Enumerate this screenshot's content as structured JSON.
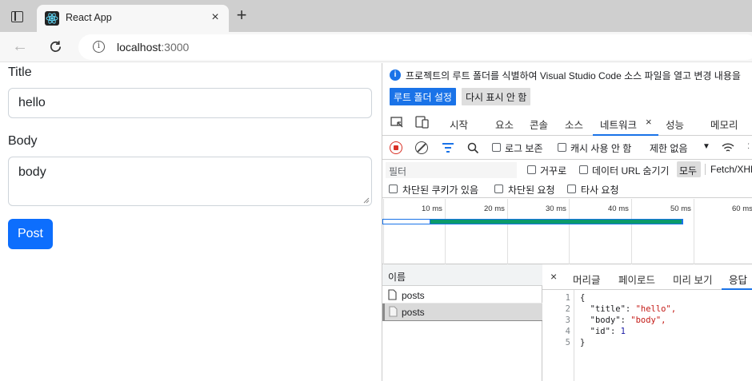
{
  "browser": {
    "tab_title": "React App",
    "url_host": "localhost",
    "url_port": ":3000"
  },
  "form": {
    "title_label": "Title",
    "title_value": "hello",
    "body_label": "Body",
    "body_value": "body",
    "post_button": "Post"
  },
  "devtools": {
    "info_text": "프로젝트의 루트 폴더를 식별하여 Visual Studio Code 소스 파일을 열고 변경 내용을",
    "info_primary_button": "루트 폴더 설정",
    "info_secondary_button": "다시 표시 안 함",
    "tabs": [
      "시작",
      "요소",
      "콘솔",
      "소스",
      "네트워크",
      "성능",
      "메모리"
    ],
    "active_tab": "네트워크",
    "preserve_log": "로그 보존",
    "disable_cache": "캐시 사용 안 함",
    "throttle": "제한 없음",
    "filter_placeholder": "필터",
    "invert": "거꾸로",
    "hide_data_urls": "데이터 URL 숨기기",
    "all_label": "모두",
    "fetch_xhr": "Fetch/XHR",
    "blocked_cookies": "차단된 쿠키가 있음",
    "blocked_requests": "차단된 요청",
    "third_party": "타사 요청",
    "timeline_ticks": [
      "10 ms",
      "20 ms",
      "30 ms",
      "40 ms",
      "50 ms",
      "60 ms"
    ],
    "name_header": "이름",
    "requests": [
      "posts",
      "posts"
    ],
    "detail_tabs": [
      "머리글",
      "페이로드",
      "미리 보기",
      "응답"
    ],
    "active_detail_tab": "응답",
    "response_lines": [
      {
        "n": "1",
        "key": "",
        "val": "{",
        "type": "plain"
      },
      {
        "n": "2",
        "key": "\"title\"",
        "val": "\"hello\",",
        "type": "str"
      },
      {
        "n": "3",
        "key": "\"body\"",
        "val": "\"body\",",
        "type": "str"
      },
      {
        "n": "4",
        "key": "\"id\"",
        "val": "1",
        "type": "num"
      },
      {
        "n": "5",
        "key": "",
        "val": "}",
        "type": "plain"
      }
    ]
  },
  "colors": {
    "primary": "#0d6efd",
    "devtools_accent": "#1a73e8",
    "record_red": "#d93025",
    "timeline_green": "#0b9a6b"
  }
}
